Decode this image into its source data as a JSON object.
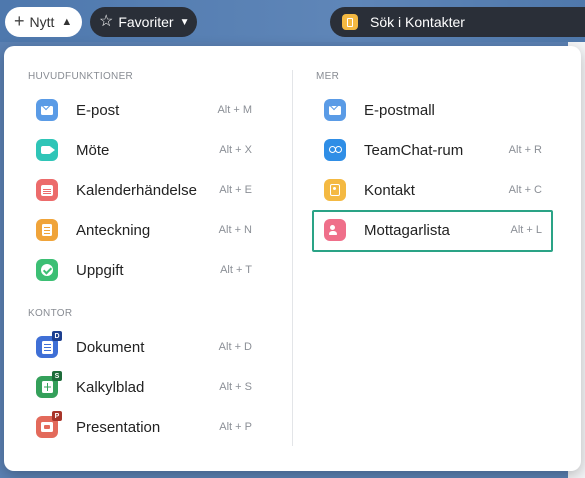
{
  "toolbar": {
    "new_label": "Nytt",
    "favorites_label": "Favoriter",
    "search_placeholder": "Sök i Kontakter"
  },
  "menu": {
    "left": {
      "sections": [
        {
          "title": "HUVUDFUNKTIONER",
          "items": [
            {
              "label": "E-post",
              "shortcut": "Alt + M",
              "icon": "mail-icon",
              "color": "#5a9be6"
            },
            {
              "label": "Möte",
              "shortcut": "Alt + X",
              "icon": "video-icon",
              "color": "#2fc5b7"
            },
            {
              "label": "Kalenderhändelse",
              "shortcut": "Alt + E",
              "icon": "calendar-icon",
              "color": "#ec6b6b"
            },
            {
              "label": "Anteckning",
              "shortcut": "Alt + N",
              "icon": "note-icon",
              "color": "#f0a43a"
            },
            {
              "label": "Uppgift",
              "shortcut": "Alt + T",
              "icon": "task-check-icon",
              "color": "#3cbf74"
            }
          ]
        },
        {
          "title": "KONTOR",
          "items": [
            {
              "label": "Dokument",
              "shortcut": "Alt + D",
              "icon": "document-icon",
              "color": "#3f6fd6",
              "badge": "D"
            },
            {
              "label": "Kalkylblad",
              "shortcut": "Alt + S",
              "icon": "spreadsheet-icon",
              "color": "#34a05a",
              "badge": "S"
            },
            {
              "label": "Presentation",
              "shortcut": "Alt + P",
              "icon": "presentation-icon",
              "color": "#e36a5b",
              "badge": "P"
            }
          ]
        }
      ]
    },
    "right": {
      "sections": [
        {
          "title": "MER",
          "items": [
            {
              "label": "E-postmall",
              "shortcut": "",
              "icon": "mail-template-icon",
              "color": "#5a9be6"
            },
            {
              "label": "TeamChat-rum",
              "shortcut": "Alt + R",
              "icon": "teamchat-icon",
              "color": "#2f8ee6"
            },
            {
              "label": "Kontakt",
              "shortcut": "Alt + C",
              "icon": "contact-book-icon",
              "color": "#f4b942"
            },
            {
              "label": "Mottagarlista",
              "shortcut": "Alt + L",
              "icon": "recipient-list-icon",
              "color": "#ef6f8a"
            }
          ]
        }
      ]
    }
  }
}
